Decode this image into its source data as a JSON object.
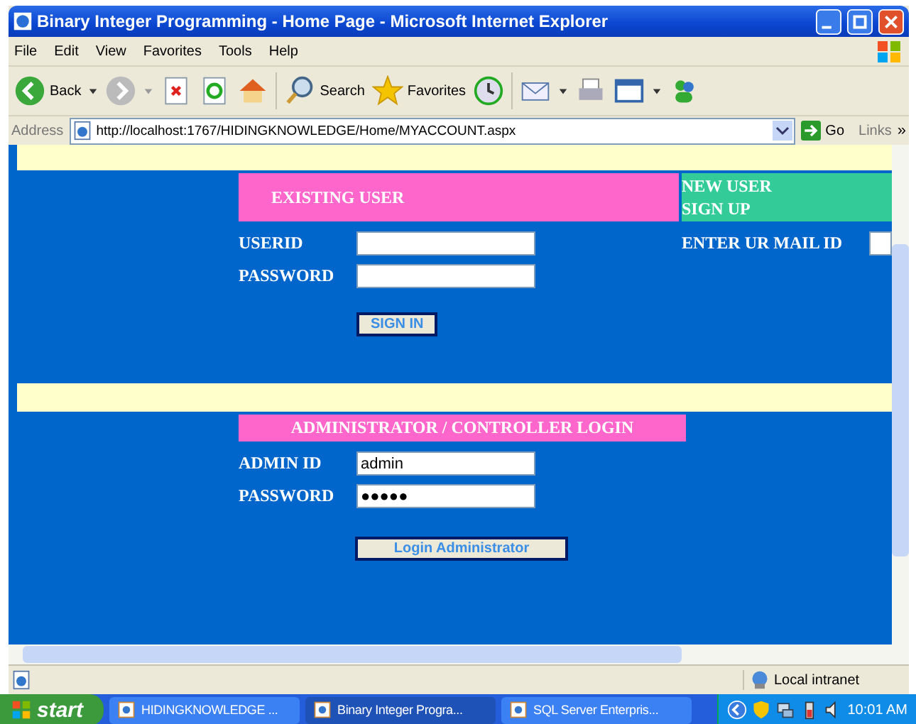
{
  "window": {
    "title": "Binary Integer Programming - Home Page - Microsoft Internet Explorer"
  },
  "menu": [
    "File",
    "Edit",
    "View",
    "Favorites",
    "Tools",
    "Help"
  ],
  "toolbar": {
    "back": "Back",
    "search": "Search",
    "favorites": "Favorites"
  },
  "address": {
    "label": "Address",
    "url": "http://localhost:1767/HIDINGKNOWLEDGE/Home/MYACCOUNT.aspx",
    "go": "Go",
    "links": "Links",
    "more": "»"
  },
  "existing_user": {
    "heading": "EXISTING USER",
    "fields": [
      {
        "label": "USERID"
      },
      {
        "label": "PASSWORD"
      }
    ],
    "button": "SIGN IN"
  },
  "new_user": {
    "heading_lines": [
      "NEW USER",
      "SIGN UP"
    ],
    "field_label": "ENTER UR MAIL ID"
  },
  "admin": {
    "heading": "ADMINISTRATOR / CONTROLLER LOGIN",
    "fields": [
      {
        "label": "ADMIN ID",
        "value": "admin"
      },
      {
        "label": "PASSWORD",
        "value": "●●●●●"
      }
    ],
    "button": "Login Administrator"
  },
  "status_bar": {
    "zone": "Local intranet"
  },
  "taskbar": {
    "start": "start",
    "tasks": [
      {
        "label": "HIDINGKNOWLEDGE ...",
        "selected": false
      },
      {
        "label": "Binary Integer Progra...",
        "selected": true
      },
      {
        "label": "SQL Server Enterpris...",
        "selected": false
      }
    ],
    "clock": "10:01 AM"
  }
}
